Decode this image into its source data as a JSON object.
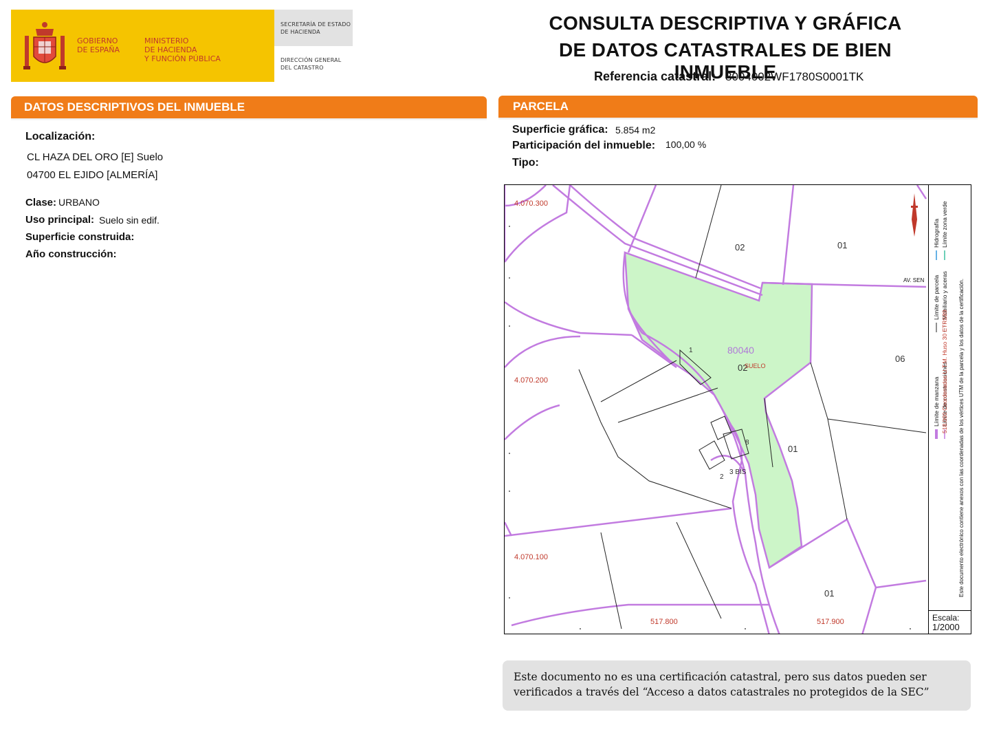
{
  "header": {
    "logo": {
      "gobierno": "GOBIERNO",
      "espana": "DE ESPAÑA",
      "ministerio_1": "MINISTERIO",
      "ministerio_2": "DE HACIENDA",
      "ministerio_3": "Y FUNCIÓN PÚBLICA",
      "secretaria_1": "SECRETARÍA DE ESTADO",
      "secretaria_2": "DE HACIENDA",
      "direccion_1": "DIRECCIÓN GENERAL",
      "direccion_2": "DEL CATASTRO"
    },
    "title_line1": "CONSULTA DESCRIPTIVA Y GRÁFICA",
    "title_line2": "DE DATOS CATASTRALES DE BIEN INMUEBLE",
    "ref_label": "Referencia catastral:",
    "ref_value": "8004002WF1780S0001TK"
  },
  "left_section": {
    "title": "DATOS DESCRIPTIVOS DEL INMUEBLE",
    "localizacion_label": "Localización:",
    "address_line1": "CL HAZA DEL ORO [E]  Suelo",
    "address_line2": "04700 EL EJIDO [ALMERÍA]",
    "clase_label": "Clase:",
    "clase_value": "URBANO",
    "uso_label": "Uso principal:",
    "uso_value": "Suelo sin edif.",
    "superficie_label": "Superficie construida:",
    "anio_label": "Año construcción:"
  },
  "right_section": {
    "title": "PARCELA",
    "superficie_label": "Superficie gráfica:",
    "superficie_value": "5.854 m2",
    "participacion_label": "Participación del inmueble:",
    "participacion_value": "100,00 %",
    "tipo_label": "Tipo:"
  },
  "map": {
    "coord_labels": [
      "4.070.300",
      "4.070.200",
      "4.070.100",
      "517.800",
      "517.900"
    ],
    "parcel_labels": [
      "02",
      "01",
      "06",
      "01",
      "01",
      "02"
    ],
    "manzana": "80040",
    "suelo_label": "SUELO",
    "street_label": "AV. SEN",
    "numbers": [
      "1",
      "8",
      "2",
      "3 BIS",
      "3"
    ],
    "colors": {
      "parcel_line": "#c27be0",
      "highlight_fill": "#ccf5c8",
      "coord_text": "#c0392b"
    }
  },
  "legend": {
    "line1": "Límite de manzana",
    "line2": "Límite de parcela",
    "line3": "Hidrografía",
    "line4": "Límite de construcciones",
    "line5": "Mobiliario y aceras",
    "line6": "Límite zona verde",
    "coords": "518.000 Coordenadas U.T.M. Huso 30 ETRS89",
    "disclaimer": "Este documento electrónico contiene anexos con las coordenadas de los vértices UTM de la parcela y los datos de la certificación."
  },
  "scale": {
    "label": "Escala:",
    "value": "1/2000"
  },
  "footer_note": "Este documento no es una certificación catastral, pero sus datos pueden ser verificados a través del “Acceso a datos catastrales no protegidos de la SEC”"
}
